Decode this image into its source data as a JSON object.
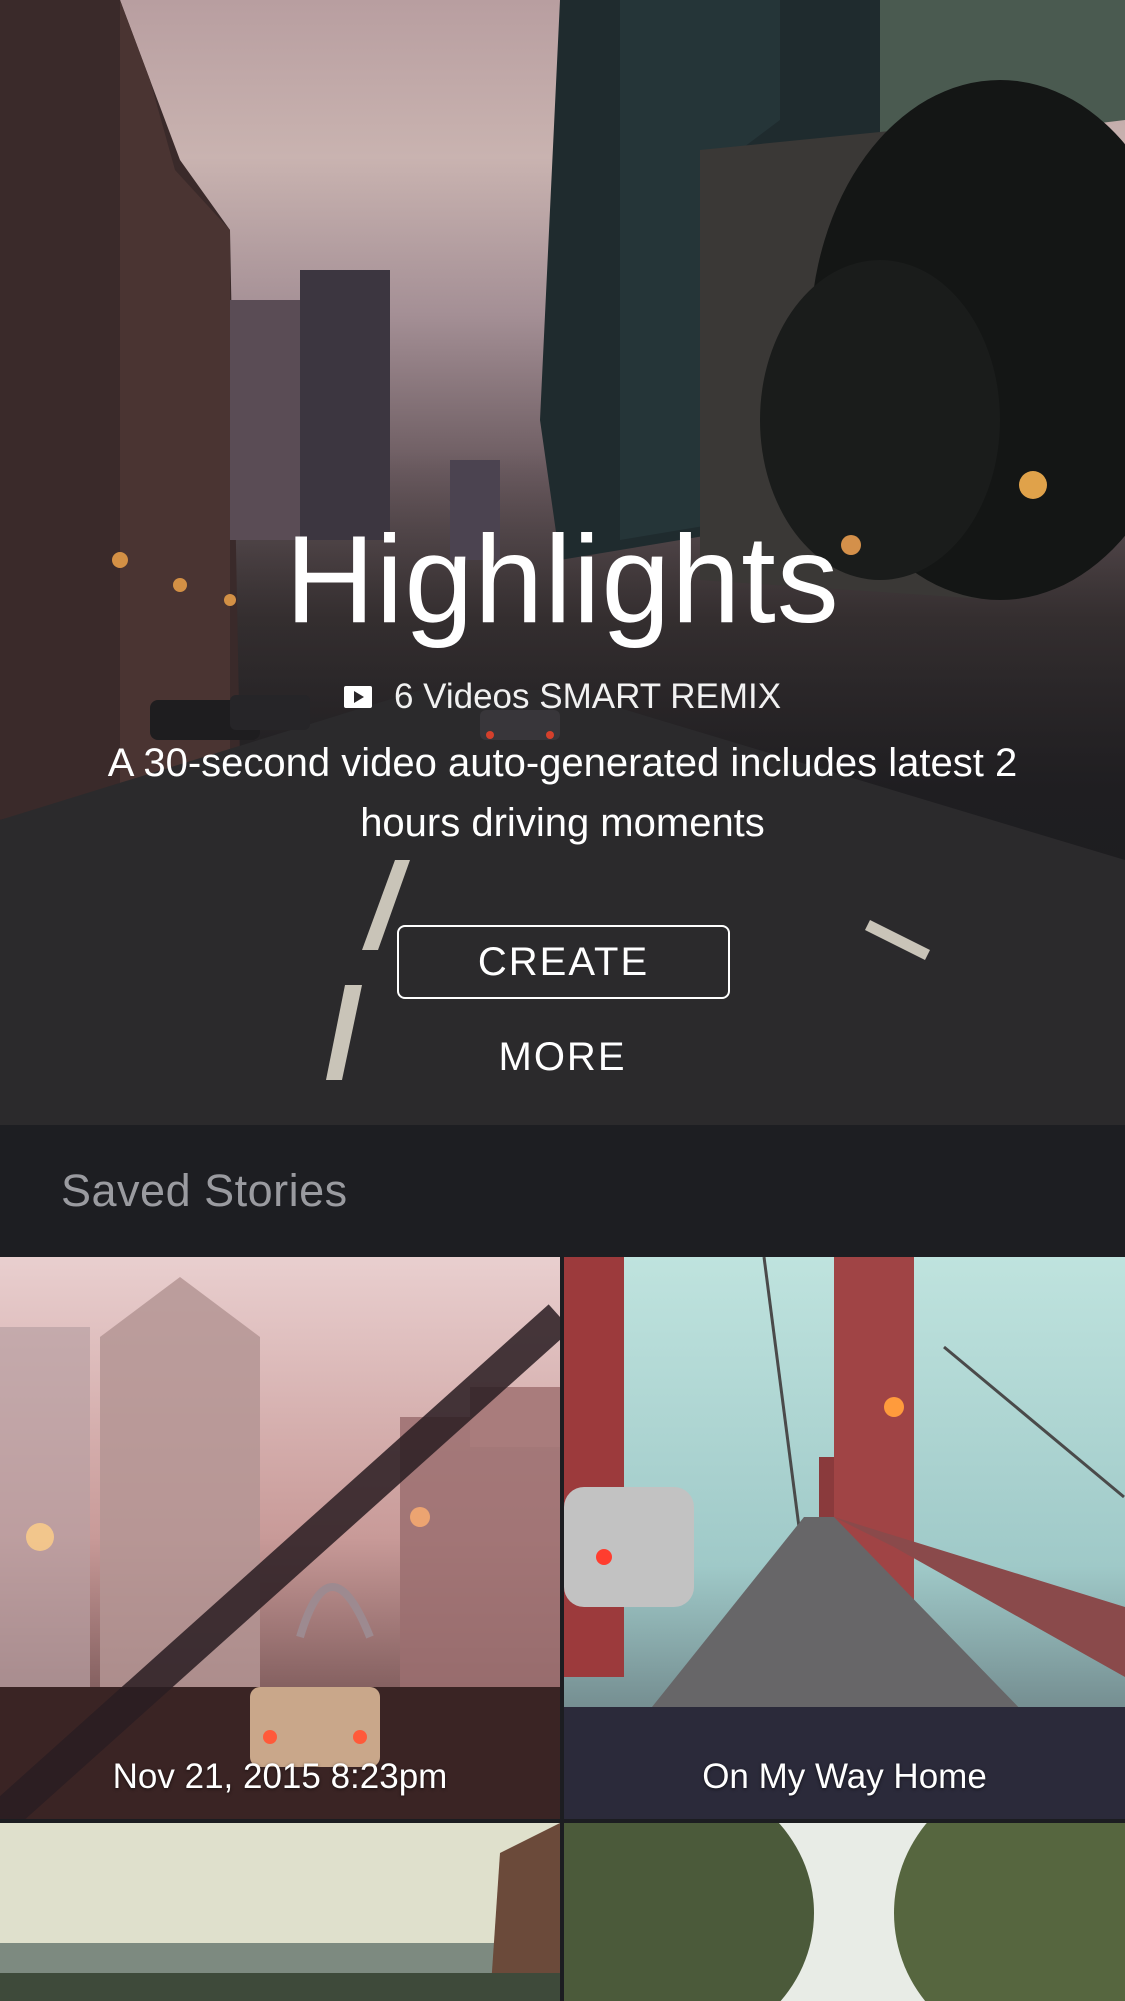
{
  "hero": {
    "title": "Highlights",
    "meta": "6 Videos SMART REMIX",
    "description": "A 30-second video auto-generated includes latest 2 hours driving moments",
    "create_label": "CREATE",
    "more_label": "MORE",
    "icon": "video-play-icon"
  },
  "saved_stories": {
    "title": "Saved Stories",
    "items": [
      {
        "caption": "Nov 21, 2015  8:23pm"
      },
      {
        "caption": "On My Way Home"
      },
      {
        "caption": ""
      },
      {
        "caption": ""
      }
    ]
  },
  "colors": {
    "background": "#1c1d21",
    "section_title": "#9a9ba0",
    "text": "#ffffff"
  }
}
